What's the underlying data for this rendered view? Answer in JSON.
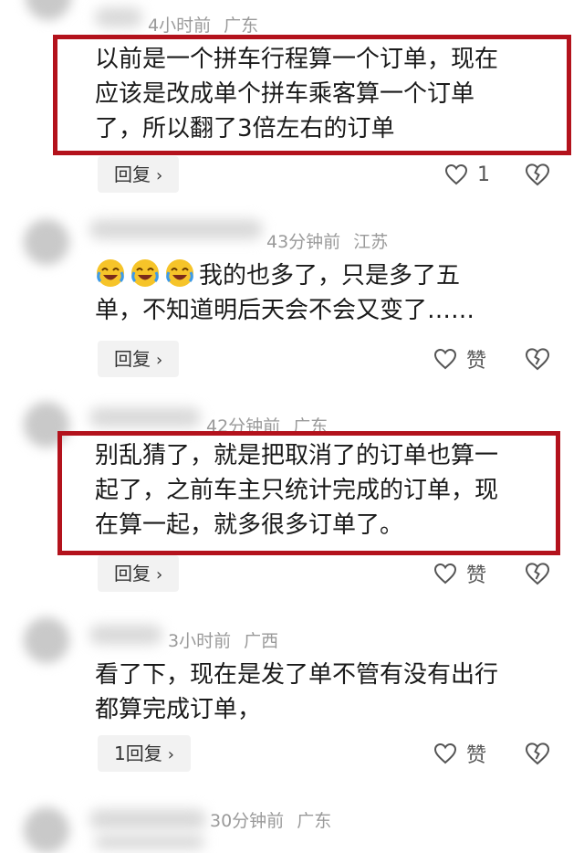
{
  "comments": [
    {
      "time": "4小时前",
      "region": "广东",
      "lines": [
        "以前是一个拼车行程算一个订单，现在",
        "应该是改成单个拼车乘客算一个订单",
        "了，所以翻了3倍左右的订单"
      ],
      "reply_label": "回复",
      "like_label": "1",
      "highlighted": true
    },
    {
      "time": "43分钟前",
      "region": "江苏",
      "lines": [
        "我的也多了，只是多了五",
        "单，不知道明后天会不会又变了……"
      ],
      "reply_label": "回复",
      "like_label": "赞",
      "emoji_count": 3,
      "highlighted": false
    },
    {
      "time": "42分钟前",
      "region": "广东",
      "lines": [
        "别乱猜了，就是把取消了的订单也算一",
        "起了，之前车主只统计完成的订单，现",
        "在算一起，就多很多订单了。"
      ],
      "reply_label": "回复",
      "like_label": "赞",
      "highlighted": true
    },
    {
      "time": "3小时前",
      "region": "广西",
      "lines": [
        "看了下，现在是发了单不管有没有出行",
        "都算完成订单，"
      ],
      "reply_label": "1回复",
      "like_label": "赞",
      "highlighted": false
    },
    {
      "time": "30分钟前",
      "region": "广东",
      "lines": [],
      "highlighted": false
    }
  ],
  "colors": {
    "highlight_border": "#b3121c",
    "meta_text": "#9a9a9a",
    "reply_bg": "#f2f2f2"
  },
  "icons": {
    "like": "heart-outline-icon",
    "dislike": "broken-heart-icon",
    "emoji": "laughing-crying-emoji"
  }
}
